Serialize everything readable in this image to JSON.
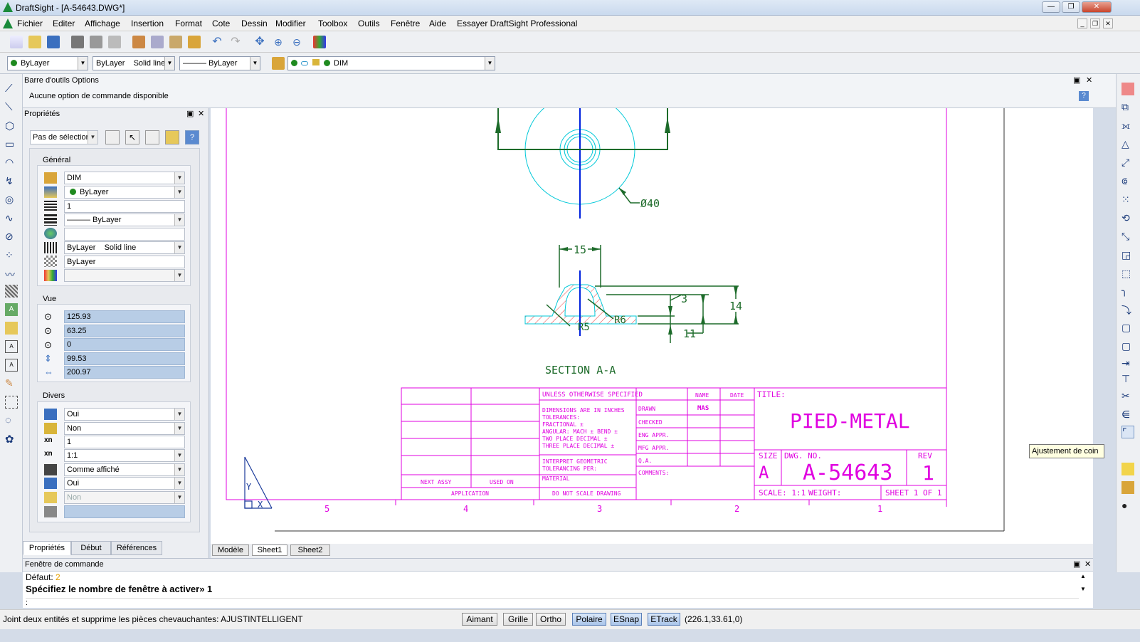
{
  "window": {
    "title": "DraftSight - [A-54643.DWG*]"
  },
  "menu": [
    "Fichier",
    "Editer",
    "Affichage",
    "Insertion",
    "Format",
    "Cote",
    "Dessin",
    "Modifier",
    "Toolbox",
    "Outils",
    "Fenêtre",
    "Aide",
    "Essayer DraftSight Professional"
  ],
  "toolbar2": {
    "color": "ByLayer",
    "linestyle_a": "ByLayer",
    "linestyle_b": "Solid line",
    "lineweight": "——— ByLayer",
    "layer": "DIM"
  },
  "options_bar": {
    "title": "Barre d'outils Options",
    "message": "Aucune option de commande disponible"
  },
  "properties": {
    "title": "Propriétés",
    "selection": "Pas de sélection",
    "general_label": "Général",
    "general": {
      "layer": "DIM",
      "color": "ByLayer",
      "scale": "1",
      "lineweight": "——— ByLayer",
      "hyperlink": "",
      "linestyle_a": "ByLayer",
      "linestyle_b": "Solid line",
      "transparency": "ByLayer",
      "material": ""
    },
    "view_label": "Vue",
    "view": {
      "center_x": "125.93",
      "center_y": "63.25",
      "center_z": "0",
      "height": "99.53",
      "width": "200.97"
    },
    "misc_label": "Divers",
    "misc": {
      "ucs_icon": "Oui",
      "ucs_at_origin": "Non",
      "annotation_scale_n": "1",
      "annotation_scale": "1:1",
      "display": "Comme affiché",
      "ucs_per_viewport": "Oui",
      "disabled": "Non",
      "last": ""
    },
    "tabs": [
      "Propriétés",
      "Début",
      "Références"
    ]
  },
  "sheet_tabs": [
    "Modèle",
    "Sheet1",
    "Sheet2"
  ],
  "drawing": {
    "dim_40": "Ø40",
    "dim_15": "15",
    "dim_3": "3",
    "dim_14": "14",
    "dim_11": "11",
    "dim_r6": "R6",
    "dim_r5": "R5",
    "section": "SECTION A-A",
    "tb_unless": "UNLESS OTHERWISE SPECIFIED",
    "tb_dims": "DIMENSIONS ARE IN INCHES",
    "tb_tol": "TOLERANCES:",
    "tb_frac": "FRACTIONAL ±",
    "tb_ang": "ANGULAR: MACH ±      BEND ±",
    "tb_two": "TWO PLACE DECIMAL   ±",
    "tb_three": "THREE PLACE DECIMAL  ±",
    "tb_interp": "INTERPRET GEOMETRIC",
    "tb_tolper": "TOLERANCING PER:",
    "tb_material": "MATERIAL",
    "tb_noscale": "DO NOT SCALE DRAWING",
    "tb_nextassy": "NEXT ASSY",
    "tb_usedon": "USED ON",
    "tb_application": "APPLICATION",
    "tb_name": "NAME",
    "tb_date": "DATE",
    "tb_drawn": "DRAWN",
    "tb_drawn_name": "MAS",
    "tb_checked": "CHECKED",
    "tb_eng": "ENG APPR.",
    "tb_mfg": "MFG APPR.",
    "tb_qa": "Q.A.",
    "tb_comments": "COMMENTS:",
    "tb_title_lbl": "TITLE:",
    "tb_title": "PIED-METAL",
    "tb_size_lbl": "SIZE",
    "tb_size": "A",
    "tb_dwgno_lbl": "DWG.  NO.",
    "tb_dwgno": "A-54643",
    "tb_rev_lbl": "REV",
    "tb_rev": "1",
    "tb_scale": "SCALE: 1:1",
    "tb_weight": "WEIGHT:",
    "tb_sheet": "SHEET 1 OF 1",
    "zone_5": "5",
    "zone_4": "4",
    "zone_3": "3",
    "zone_2": "2",
    "zone_1": "1",
    "ucs_x": "X",
    "ucs_y": "Y",
    "sec_a": "A"
  },
  "command": {
    "title": "Fenêtre de commande",
    "default_label": "Défaut:",
    "default_value": "2",
    "prompt": "Spécifiez le nombre de fenêtre à activer» 1",
    "input": ":"
  },
  "tooltip": "Ajustement de coin",
  "status": {
    "message": "Joint deux entités et supprime les pièces chevauchantes: AJUSTINTELLIGENT",
    "buttons": [
      "Aimant",
      "Grille",
      "Ortho",
      "Polaire",
      "ESnap",
      "ETrack"
    ],
    "coords": "(226.1,33.61,0)"
  },
  "colors": {
    "title_block": "#e000e0",
    "geometry": "#1d6b2a",
    "centerline": "#0022dd",
    "cyan": "#00c8d8",
    "hatch": "#e83a3a"
  }
}
